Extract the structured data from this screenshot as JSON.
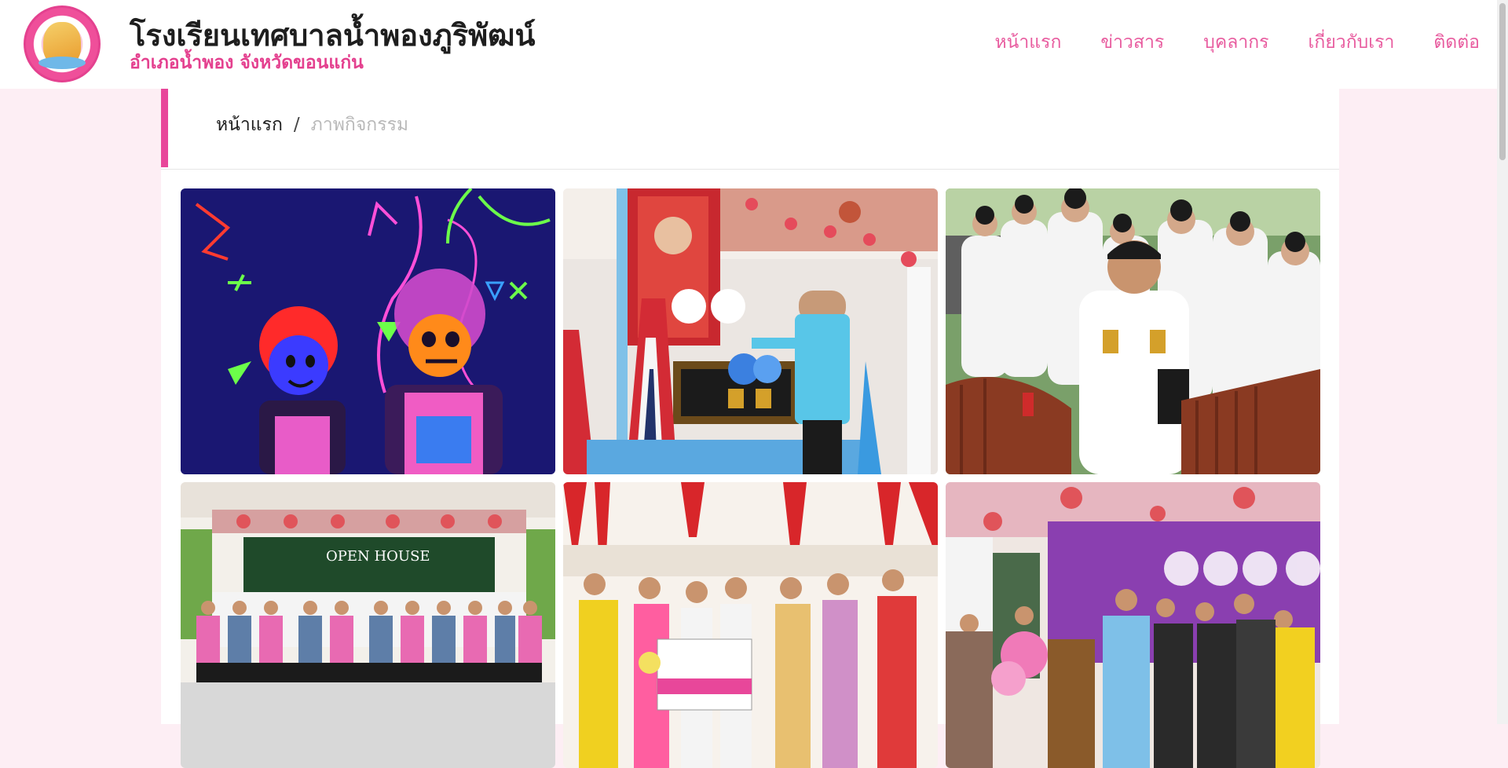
{
  "header": {
    "school_name": "โรงเรียนเทศบาลน้ำพองภูริพัฒน์",
    "school_location": "อำเภอน้ำพอง จังหวัดขอนแก่น",
    "logo_icon": "school-emblem-icon"
  },
  "nav": {
    "items": [
      "หน้าแรก",
      "ข่าวสาร",
      "บุคลากร",
      "เกี่ยวกับเรา",
      "ติดต่อ"
    ]
  },
  "breadcrumb": {
    "home": "หน้าแรก",
    "separator": "/",
    "current": "ภาพกิจกรรม"
  },
  "gallery": {
    "photos": [
      {
        "subject": "neon-costume-activity-photo",
        "open_house_sign": "",
        "banner_text": ""
      },
      {
        "subject": "flower-tribute-ceremony-photo",
        "open_house_sign": "",
        "banner_text": ""
      },
      {
        "subject": "officials-seated-ceremony-photo",
        "open_house_sign": "",
        "banner_text": ""
      },
      {
        "subject": "open-house-group-photo",
        "open_house_sign": "OPEN HOUSE",
        "banner_text": ""
      },
      {
        "subject": "sponsorship-donation-photo",
        "open_house_sign": "",
        "banner_text": ""
      },
      {
        "subject": "academic-event-stage-photo",
        "open_house_sign": "",
        "banner_text": ""
      }
    ]
  },
  "colors": {
    "brand_pink": "#e8479a",
    "nav_pink": "#e85c9f",
    "page_bg": "#fdeef4"
  }
}
